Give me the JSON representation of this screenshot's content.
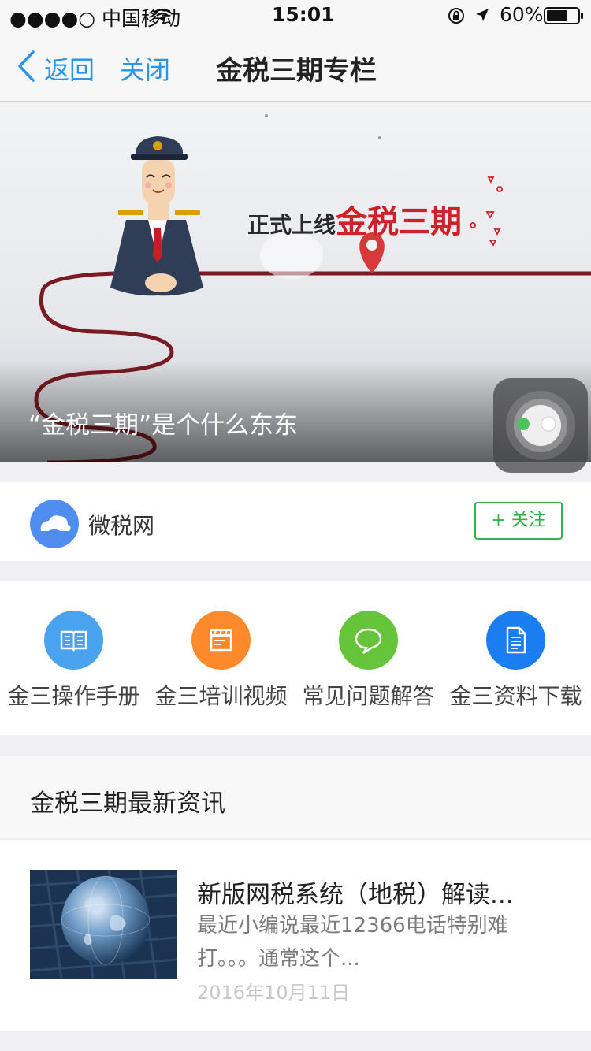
{
  "status_bar": {
    "carrier": "●●●●○ 中国移动",
    "time": "15:01",
    "battery": "60%"
  },
  "nav": {
    "back_label": "返回",
    "close_label": "关闭",
    "title": "金税三期专栏"
  },
  "banner": {
    "slogan_prefix": "正式上线",
    "slogan_main": "金税三期",
    "caption": "“金税三期”是个什么东东"
  },
  "author": {
    "name": "微税网",
    "follow_label": "+ 关注"
  },
  "menu": {
    "items": [
      {
        "label": "金三操作手册",
        "icon": "book-icon",
        "color": "#4aa3ee"
      },
      {
        "label": "金三培训视频",
        "icon": "clapperboard-icon",
        "color": "#ff8a2b"
      },
      {
        "label": "常见问题解答",
        "icon": "chat-bubble-icon",
        "color": "#66c43a"
      },
      {
        "label": "金三资料下载",
        "icon": "document-icon",
        "color": "#1a7df2"
      }
    ]
  },
  "news": {
    "section_title": "金税三期最新资讯",
    "articles": [
      {
        "title": "新版网税系统（地税）解读...",
        "summary": "最近小编说最近12366电话特别难打。。。通常这个...",
        "date": "2016年10月11日"
      }
    ]
  },
  "colors": {
    "accent_blue": "#2b95e9",
    "follow_green": "#33b34a",
    "slogan_red": "#d0202a"
  }
}
